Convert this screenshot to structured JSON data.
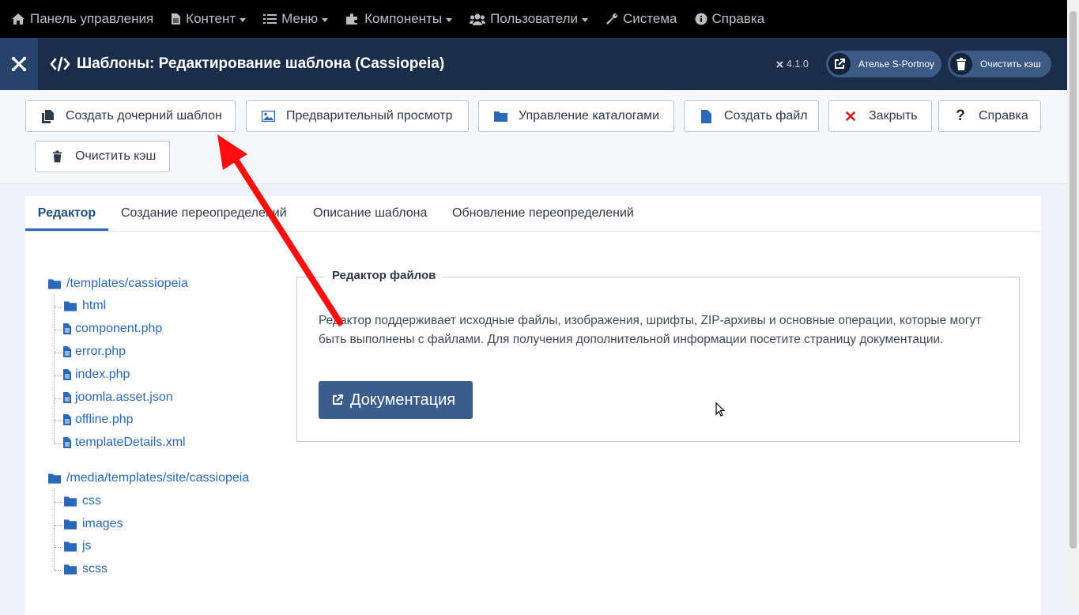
{
  "menubar": {
    "items": [
      {
        "label": "Панель управления",
        "icon": "home-icon",
        "dropdown": false
      },
      {
        "label": "Контент",
        "icon": "file-icon",
        "dropdown": true
      },
      {
        "label": "Меню",
        "icon": "list-icon",
        "dropdown": true
      },
      {
        "label": "Компоненты",
        "icon": "puzzle-icon",
        "dropdown": true
      },
      {
        "label": "Пользователи",
        "icon": "users-icon",
        "dropdown": true
      },
      {
        "label": "Система",
        "icon": "wrench-icon",
        "dropdown": false
      },
      {
        "label": "Справка",
        "icon": "info-icon",
        "dropdown": false
      }
    ]
  },
  "header": {
    "title": "Шаблоны: Редактирование шаблона (Cassiopeia)",
    "version": "4.1.0",
    "site_button": "Ателье S-Portnoy",
    "cache_button": "Очистить кэш"
  },
  "toolbar": {
    "create_child": "Создать дочерний шаблон",
    "preview": "Предварительный просмотр",
    "manage_folders": "Управление каталогами",
    "create_file": "Создать файл",
    "close": "Закрыть",
    "help": "Справка",
    "clear_cache": "Очистить кэш"
  },
  "tabs": [
    "Редактор",
    "Создание переопределений",
    "Описание шаблона",
    "Обновление переопределений"
  ],
  "tree": {
    "root1": "/templates/cassiopeia",
    "root1_children": {
      "folder": "html",
      "files": [
        "component.php",
        "error.php",
        "index.php",
        "joomla.asset.json",
        "offline.php",
        "templateDetails.xml"
      ]
    },
    "root2": "/media/templates/site/cassiopeia",
    "root2_children": [
      "css",
      "images",
      "js",
      "scss"
    ]
  },
  "editor": {
    "legend": "Редактор файлов",
    "text": "Редактор поддерживает исходные файлы, изображения, шрифты, ZIP-архивы и основные операции, которые могут быть выполнены с файлами. Для получения дополнительной информации посетите страницу документации.",
    "doc_button": "Документация"
  },
  "colors": {
    "menubar_bg": "#000000",
    "header_bg": "#1a2e4a",
    "link": "#2a69b8",
    "primary_button": "#3b5d8c",
    "annotation_arrow": "#ff0000"
  }
}
